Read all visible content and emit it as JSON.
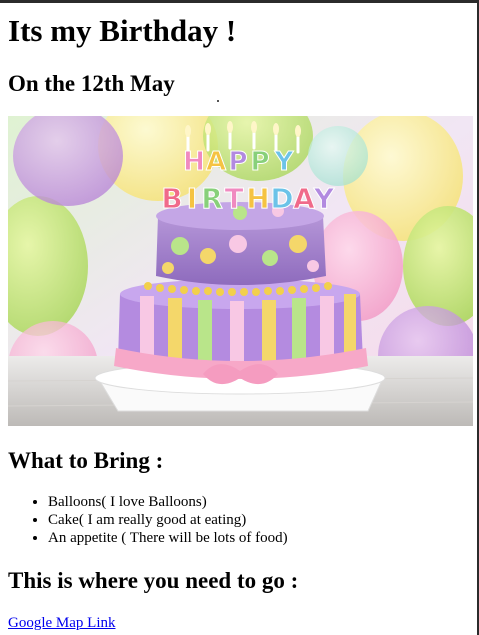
{
  "page": {
    "title": "Its my Birthday !",
    "date_heading": "On the 12th May",
    "bring_heading": "What to Bring :",
    "bring_items": [
      "Balloons( I love Balloons)",
      "Cake( I am really good at eating)",
      "An appetite ( There will be lots of food)"
    ],
    "location_heading": "This is where you need to go :",
    "map_link_text": "Google Map Link"
  },
  "image": {
    "subject": "birthday-cake-photo",
    "cake_topper_top": "HAPPY",
    "cake_topper_bottom": "BIRTHDAY"
  },
  "colors": {
    "text": "#000000",
    "link": "#0000ee",
    "window_border": "#2b2b2b"
  }
}
